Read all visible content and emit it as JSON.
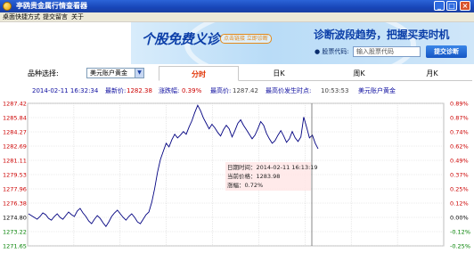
{
  "window": {
    "title": "亭鸥贵金属行情查看器",
    "min_glyph": "_",
    "max_glyph": "□",
    "close_glyph": "×"
  },
  "menu": [
    "桌面快捷方式",
    "提交留言",
    "关于"
  ],
  "banner": {
    "headline": "个股免费义诊",
    "pill": "点击链接 立即诊断",
    "slogan": "诊断波段趋势，把握买卖时机",
    "code_label": "● 股票代码:",
    "code_placeholder": "输入股票代码",
    "diagnose_button": "提交诊断"
  },
  "selector": {
    "label": "品种选择:",
    "selected": "美元账户黄金",
    "arrow": "▼",
    "tabs": [
      "分时",
      "日K",
      "周K",
      "月K"
    ],
    "active_tab": 0
  },
  "info": {
    "datetime": "2014-02-11 16:32:34",
    "latest_label": "最新价:",
    "latest_value": "1282.38",
    "change_label": "涨跌幅:",
    "change_value": "0.39%",
    "high_label": "最高价:",
    "high_value": "1287.42",
    "high_time_label": "最高价发生时点:",
    "high_time_value": "10:53:53",
    "product": "美元账户黄金"
  },
  "tooltip": {
    "time_line": "日期时间：2014-02-11 16:13:19",
    "price_line": "当前价格：1283.98",
    "change_line": "涨幅：0.72%"
  },
  "colors": {
    "up": "#cc0000",
    "down": "#008000",
    "line": "#000080",
    "grid": "#d8d8d8"
  },
  "chart_data": {
    "type": "line",
    "y_ticks_left": [
      "1287.42",
      "1285.84",
      "1284.27",
      "1282.69",
      "1281.11",
      "1279.53",
      "1277.96",
      "1276.38",
      "1274.80",
      "1273.22",
      "1271.65"
    ],
    "y_ticks_right": [
      "0.89%",
      "0.87%",
      "0.74%",
      "0.62%",
      "0.49%",
      "0.37%",
      "0.25%",
      "0.12%",
      "0.00%",
      "-0.12%",
      "-0.25%"
    ],
    "ylim": [
      1271.65,
      1287.42
    ],
    "reference_price": 1274.8,
    "series": [
      {
        "values": [
          1275.2,
          1275.0,
          1274.8,
          1274.6,
          1274.9,
          1275.3,
          1275.1,
          1274.7,
          1274.5,
          1274.9,
          1275.2,
          1274.8,
          1274.6,
          1275.0,
          1275.4,
          1275.1,
          1274.9,
          1275.5,
          1275.8,
          1275.3,
          1274.9,
          1274.4,
          1274.1,
          1274.6,
          1275.0,
          1274.7,
          1274.2,
          1273.8,
          1274.3,
          1274.9,
          1275.3,
          1275.6,
          1275.2,
          1274.8,
          1274.5,
          1274.9,
          1275.2,
          1274.8,
          1274.3,
          1274.1,
          1274.6,
          1275.1,
          1275.4,
          1276.5,
          1278.0,
          1279.8,
          1281.2,
          1282.1,
          1283.0,
          1282.6,
          1283.4,
          1284.0,
          1283.6,
          1283.9,
          1284.3,
          1284.0,
          1284.8,
          1285.5,
          1286.4,
          1287.2,
          1286.6,
          1285.8,
          1285.2,
          1284.6,
          1285.1,
          1284.7,
          1284.2,
          1283.8,
          1284.5,
          1285.0,
          1284.6,
          1283.7,
          1284.4,
          1285.2,
          1285.6,
          1285.0,
          1284.5,
          1284.0,
          1283.5,
          1283.9,
          1284.6,
          1285.4,
          1285.0,
          1284.1,
          1283.5,
          1283.0,
          1283.3,
          1283.9,
          1284.4,
          1283.8,
          1283.1,
          1283.5,
          1284.3,
          1283.6,
          1283.2,
          1283.7,
          1285.9,
          1284.8,
          1283.6,
          1283.9,
          1283.0,
          1282.4
        ]
      }
    ],
    "grid": true
  }
}
